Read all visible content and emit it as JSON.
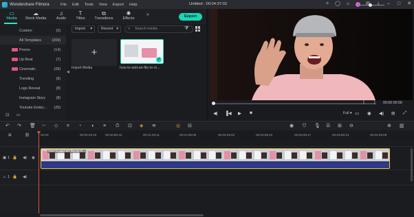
{
  "app": {
    "name": "Wondershare Filmora",
    "doc_title": "Untitled : 00:04:37:02"
  },
  "menu": [
    "File",
    "Edit",
    "Tools",
    "View",
    "Export",
    "Help"
  ],
  "tabs": [
    {
      "label": "Media",
      "icon": "folder-icon"
    },
    {
      "label": "Stock Media",
      "icon": "cloud-icon"
    },
    {
      "label": "Audio",
      "icon": "music-note-icon"
    },
    {
      "label": "Titles",
      "icon": "text-t-icon"
    },
    {
      "label": "Transitions",
      "icon": "transition-icon"
    },
    {
      "label": "Effects",
      "icon": "effects-icon"
    }
  ],
  "export_label": "Export",
  "library": [
    {
      "label": "Custom",
      "count": "(0)"
    },
    {
      "label": "All Templates",
      "count": "(209)"
    },
    {
      "label": "Promo",
      "count": "(14)"
    },
    {
      "label": "Up Beat",
      "count": "(7)"
    },
    {
      "label": "Cinematic",
      "count": "(28)"
    },
    {
      "label": "Trending",
      "count": "(8)"
    },
    {
      "label": "Logo Reveal",
      "count": "(8)"
    },
    {
      "label": "Instagram Story",
      "count": "(8)"
    },
    {
      "label": "Youtube Endsc...",
      "count": "(25)"
    }
  ],
  "media_bar": {
    "import": "Import",
    "record": "Record",
    "search_placeholder": "Search media"
  },
  "media_items": [
    {
      "label": "Import Media"
    },
    {
      "label": "how-to-add-art-file-to-m..."
    }
  ],
  "player": {
    "time": "00:00:00:00",
    "quality": "Full",
    "bracket_in": "{",
    "bracket_out": "}"
  },
  "ruler": [
    "00:00",
    "00:00:29:19",
    "00:00:59:15",
    "00:01:29:11",
    "00:01:59:06",
    "00:02:29:02",
    "00:02:58:22",
    "00:03:28:17",
    "00:03:58:13",
    "00:04:28:09"
  ],
  "tracks": {
    "video_label": "1",
    "audio_label": "1",
    "clip_title": "how-to-add-art-file-to-m..."
  },
  "colors": {
    "accent": "#19d6b4",
    "playhead": "#e0523a",
    "clip_border": "#f0c93a"
  }
}
